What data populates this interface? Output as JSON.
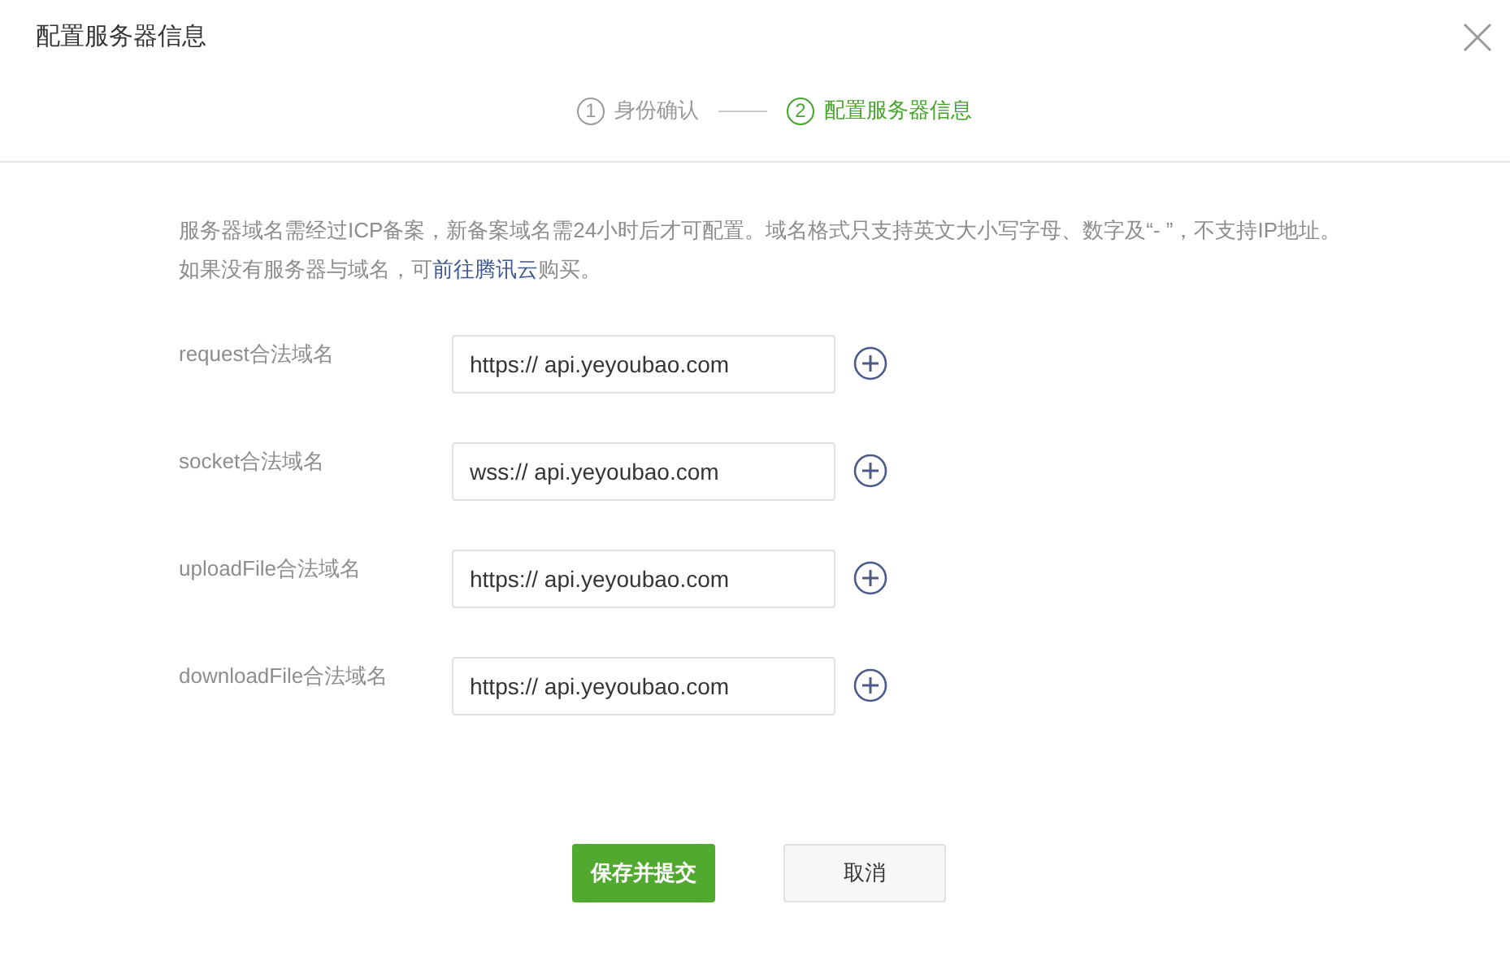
{
  "dialog": {
    "title": "配置服务器信息"
  },
  "steps": [
    {
      "number": "1",
      "label": "身份确认",
      "selected": false
    },
    {
      "number": "2",
      "label": "配置服务器信息",
      "selected": true
    }
  ],
  "notice": {
    "before": "服务器域名需经过ICP备案，新备案域名需24小时后才可配置。域名格式只支持英文大小写字母、数字及“- ”，不支持IP地址。如果没有服务器与域名，可",
    "link": "前往腾讯云",
    "after": "购买。"
  },
  "fields": [
    {
      "label": "request合法域名",
      "value": "https:// api.yeyoubao.com"
    },
    {
      "label": "socket合法域名",
      "value": "wss:// api.yeyoubao.com"
    },
    {
      "label": "uploadFile合法域名",
      "value": "https:// api.yeyoubao.com"
    },
    {
      "label": "downloadFile合法域名",
      "value": "https:// api.yeyoubao.com"
    }
  ],
  "buttons": [
    {
      "label": "保存并提交",
      "kind": "primary"
    },
    {
      "label": "取消",
      "kind": "secondary"
    }
  ]
}
